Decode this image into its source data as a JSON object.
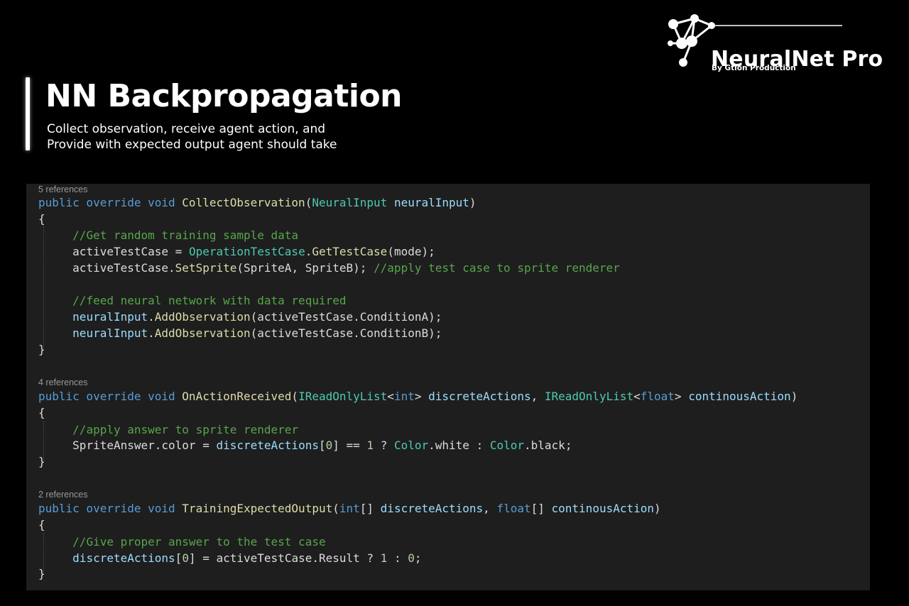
{
  "brand": {
    "name": "NeuralNet Pro",
    "byline": "By Gtion Production"
  },
  "header": {
    "title": "NN Backpropagation",
    "subtitle_line1": "Collect observation, receive agent action, and",
    "subtitle_line2": "Provide with expected output agent should take"
  },
  "colors": {
    "background": "#000000",
    "editor_background": "#1e1e1e",
    "keyword": "#569cd6",
    "method": "#dcdcaa",
    "type": "#4ec9b0",
    "parameter": "#9cdcfe",
    "comment": "#57a64a",
    "number": "#b5cea8",
    "plain": "#dcdcdc",
    "codelens": "#999999"
  },
  "code": {
    "method1": {
      "references": "5 references",
      "sig": {
        "mods": "public override void ",
        "name": "CollectObservation",
        "open": "(",
        "ptype": "NeuralInput",
        "sp": " ",
        "pname": "neuralInput",
        "close": ")"
      },
      "open_brace": "{",
      "comment1": "//Get random training sample data",
      "line2": {
        "var": "activeTestCase = ",
        "type": "OperationTestCase",
        "dot": ".",
        "method": "GetTestCase",
        "args": "(mode);"
      },
      "line3": {
        "var": "activeTestCase.",
        "method": "SetSprite",
        "args": "(SpriteA, SpriteB); ",
        "comment": "//apply test case to sprite renderer"
      },
      "comment2": "//feed neural network with data required",
      "line5": {
        "param": "neuralInput",
        "dot": ".",
        "method": "AddObservation",
        "args": "(activeTestCase.ConditionA);"
      },
      "line6": {
        "param": "neuralInput",
        "dot": ".",
        "method": "AddObservation",
        "args": "(activeTestCase.ConditionB);"
      },
      "close_brace": "}"
    },
    "method2": {
      "references": "4 references",
      "sig": {
        "mods": "public override void ",
        "name": "OnActionReceived",
        "open": "(",
        "type1": "IReadOnlyList",
        "lt1": "<",
        "kw1": "int",
        "gt1": "> ",
        "param1": "discreteActions",
        "comma": ", ",
        "type2": "IReadOnlyList",
        "lt2": "<",
        "kw2": "float",
        "gt2": "> ",
        "param2": "continousAction",
        "close": ")"
      },
      "open_brace": "{",
      "comment1": "//apply answer to sprite renderer",
      "line2": {
        "var": "SpriteAnswer.color = ",
        "param": "discreteActions",
        "b1": "[",
        "idx": "0",
        "b2": "] == ",
        "one": "1",
        "q": " ? ",
        "type1": "Color",
        "white": ".white : ",
        "type2": "Color",
        "black": ".black;"
      },
      "close_brace": "}"
    },
    "method3": {
      "references": "2 references",
      "sig": {
        "mods": "public override void ",
        "name": "TrainingExpectedOutput",
        "open": "(",
        "kw1": "int",
        "arr1": "[] ",
        "param1": "discreteActions",
        "comma": ", ",
        "kw2": "float",
        "arr2": "[] ",
        "param2": "continousAction",
        "close": ")"
      },
      "open_brace": "{",
      "comment1": "//Give proper answer to the test case",
      "line2": {
        "param": "discreteActions",
        "b1": "[",
        "idx": "0",
        "rest": "] = activeTestCase.Result ? ",
        "one": "1",
        "colon": " : ",
        "zero": "0",
        "semi": ";"
      },
      "close_brace": "}"
    }
  }
}
